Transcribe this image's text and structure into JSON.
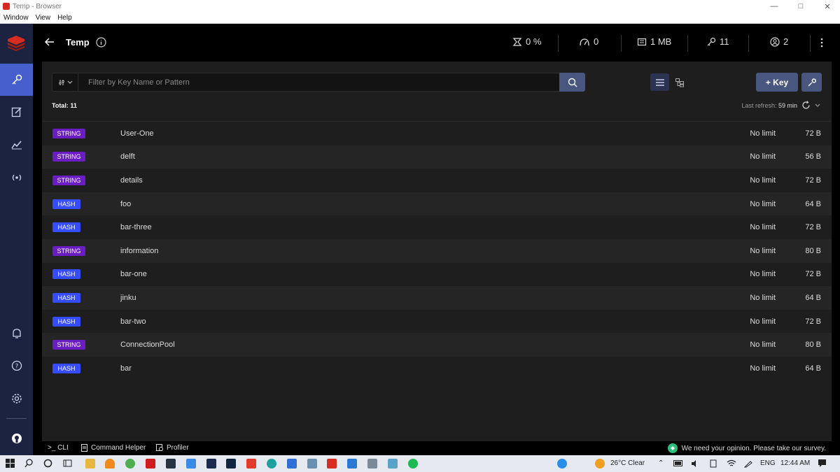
{
  "window": {
    "title": "Temp - Browser",
    "menu": [
      "Window",
      "View",
      "Help"
    ]
  },
  "header": {
    "db_name": "Temp",
    "stats": {
      "cpu": "0 %",
      "ops": "0",
      "memory": "1 MB",
      "keys": "11",
      "clients": "2"
    }
  },
  "browser": {
    "filter_placeholder": "Filter by Key Name or Pattern",
    "add_key_label": "+ Key",
    "total_label": "Total: 11",
    "last_refresh_label": "Last refresh:",
    "last_refresh_value": "59 min"
  },
  "keys": [
    {
      "type": "STRING",
      "name": "User-One",
      "ttl": "No limit",
      "size": "72 B"
    },
    {
      "type": "STRING",
      "name": "delft",
      "ttl": "No limit",
      "size": "56 B"
    },
    {
      "type": "STRING",
      "name": "details",
      "ttl": "No limit",
      "size": "72 B"
    },
    {
      "type": "HASH",
      "name": "foo",
      "ttl": "No limit",
      "size": "64 B"
    },
    {
      "type": "HASH",
      "name": "bar-three",
      "ttl": "No limit",
      "size": "72 B"
    },
    {
      "type": "STRING",
      "name": "information",
      "ttl": "No limit",
      "size": "80 B"
    },
    {
      "type": "HASH",
      "name": "bar-one",
      "ttl": "No limit",
      "size": "72 B"
    },
    {
      "type": "HASH",
      "name": "jinku",
      "ttl": "No limit",
      "size": "64 B"
    },
    {
      "type": "HASH",
      "name": "bar-two",
      "ttl": "No limit",
      "size": "72 B"
    },
    {
      "type": "STRING",
      "name": "ConnectionPool",
      "ttl": "No limit",
      "size": "80 B"
    },
    {
      "type": "HASH",
      "name": "bar",
      "ttl": "No limit",
      "size": "64 B"
    }
  ],
  "bottom": {
    "cli": ">_ CLI",
    "command_helper": "Command Helper",
    "profiler": "Profiler",
    "survey": "We need your opinion. Please take our survey."
  },
  "taskbar": {
    "weather": "26°C  Clear",
    "lang": "ENG",
    "time": "12:44 AM"
  },
  "colors": {
    "string_badge": "#6a1dc3",
    "hash_badge": "#364cff",
    "accent": "#465fcc",
    "nav_bg": "#1c2341"
  }
}
